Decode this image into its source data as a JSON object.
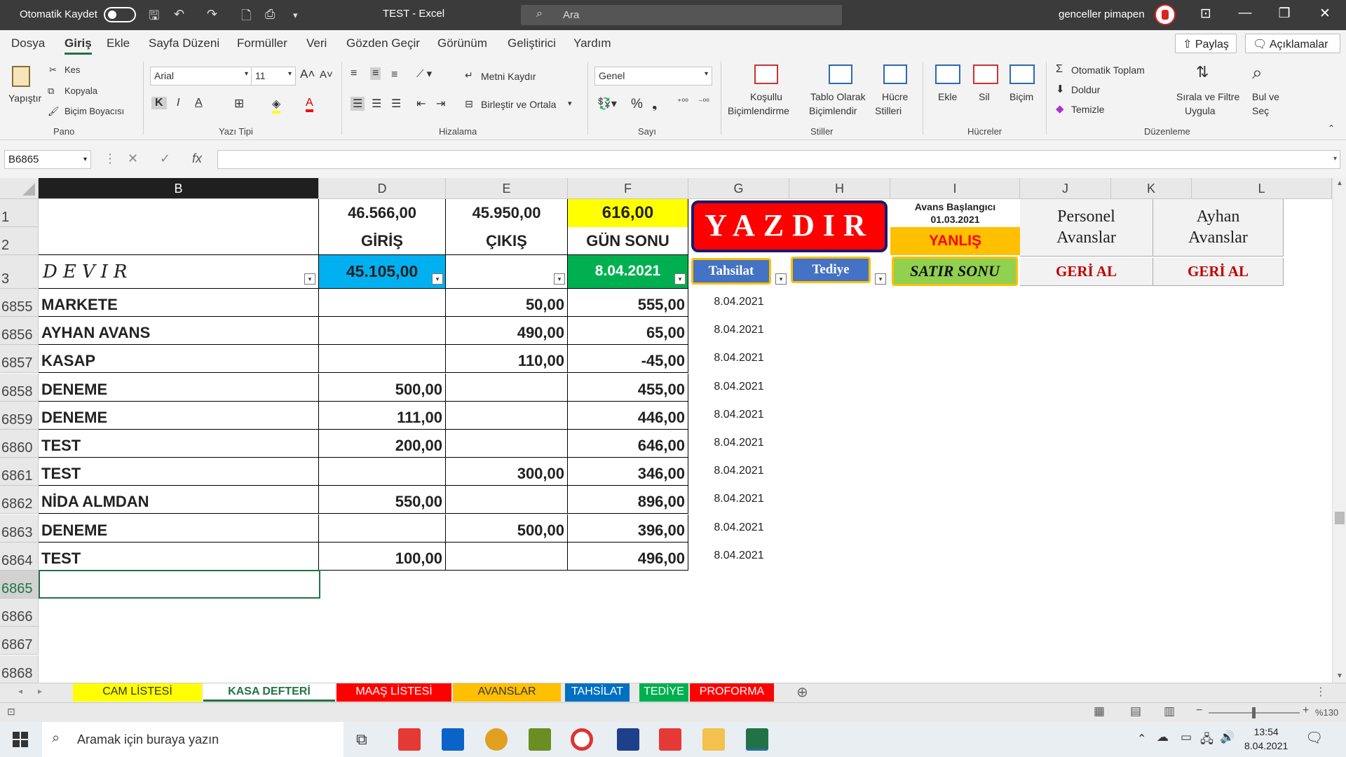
{
  "titlebar": {
    "autosave_label": "Otomatik Kaydet",
    "doc_title": "TEST  -  Excel",
    "search_placeholder": "Ara",
    "user_name": "genceller pimapen",
    "minimize": "—",
    "restore": "❐",
    "close": "✕",
    "display_icon": "⊡"
  },
  "menu": {
    "tabs": [
      "Dosya",
      "Giriş",
      "Ekle",
      "Sayfa Düzeni",
      "Formüller",
      "Veri",
      "Gözden Geçir",
      "Görünüm",
      "Geliştirici",
      "Yardım"
    ],
    "active_tab": "Giriş",
    "share_label": "Paylaş",
    "comments_label": "Açıklamalar"
  },
  "ribbon": {
    "clipboard": {
      "paste": "Yapıştır",
      "cut": "Kes",
      "copy": "Kopyala",
      "format_painter": "Biçim Boyacısı",
      "group": "Pano"
    },
    "font": {
      "name": "Arial",
      "size": "11",
      "bold": "K",
      "italic": "I",
      "underline": "A",
      "group": "Yazı Tipi"
    },
    "alignment": {
      "wrap": "Metni Kaydır",
      "merge": "Birleştir ve Ortala",
      "group": "Hizalama"
    },
    "number": {
      "format": "Genel",
      "group": "Sayı"
    },
    "styles": {
      "conditional": [
        "Koşullu",
        "Biçimlendirme"
      ],
      "table": [
        "Tablo Olarak",
        "Biçimlendir"
      ],
      "cell_styles": [
        "Hücre",
        "Stilleri"
      ],
      "group": "Stiller"
    },
    "cells": {
      "insert": "Ekle",
      "delete": "Sil",
      "format": "Biçim",
      "group": "Hücreler"
    },
    "editing": {
      "autosum": "Otomatik Toplam",
      "fill": "Doldur",
      "clear": "Temizle",
      "sort": [
        "Sırala ve Filtre",
        "Uygula"
      ],
      "find": [
        "Bul ve",
        "Seç"
      ],
      "group": "Düzenleme"
    }
  },
  "formula_bar": {
    "name_box": "B6865",
    "formula": ""
  },
  "columns": [
    "B",
    "D",
    "E",
    "F",
    "G",
    "H",
    "I",
    "J",
    "K",
    "L"
  ],
  "header_block": {
    "d1": "46.566,00",
    "d2": "GİRİŞ",
    "e1": "45.950,00",
    "e2": "ÇIKIŞ",
    "f1": "616,00",
    "f2": "GÜN SONU",
    "b3": "DEVIR",
    "d3": "45.105,00",
    "f3": "8.04.2021",
    "yazdir": "YAZDIR",
    "avans_label": "Avans Başlangıcı",
    "avans_date": "01.03.2021",
    "yanlis": "YANLIŞ",
    "tahsilat_btn": "Tahsilat",
    "tediye_btn": "Tediye",
    "satir_sonu_btn": "SATIR SONU",
    "personel": [
      "Personel",
      "Avanslar"
    ],
    "ayhan": [
      "Ayhan",
      "Avanslar"
    ],
    "geri_al_1": "GERİ AL",
    "geri_al_2": "GERİ AL"
  },
  "rows": [
    {
      "num": "6855",
      "b": "MARKETE",
      "d": "",
      "e": "50,00",
      "f": "555,00",
      "g": "8.04.2021"
    },
    {
      "num": "6856",
      "b": "AYHAN AVANS",
      "d": "",
      "e": "490,00",
      "f": "65,00",
      "g": "8.04.2021"
    },
    {
      "num": "6857",
      "b": "KASAP",
      "d": "",
      "e": "110,00",
      "f": "-45,00",
      "g": "8.04.2021"
    },
    {
      "num": "6858",
      "b": "DENEME",
      "d": "500,00",
      "e": "",
      "f": "455,00",
      "g": "8.04.2021"
    },
    {
      "num": "6859",
      "b": "DENEME",
      "d": "111,00",
      "e": "",
      "f": "446,00",
      "g": "8.04.2021"
    },
    {
      "num": "6860",
      "b": "TEST",
      "d": "200,00",
      "e": "",
      "f": "646,00",
      "g": "8.04.2021"
    },
    {
      "num": "6861",
      "b": "TEST",
      "d": "",
      "e": "300,00",
      "f": "346,00",
      "g": "8.04.2021"
    },
    {
      "num": "6862",
      "b": "NİDA ALMDAN",
      "d": "550,00",
      "e": "",
      "f": "896,00",
      "g": "8.04.2021"
    },
    {
      "num": "6863",
      "b": "DENEME",
      "d": "",
      "e": "500,00",
      "f": "396,00",
      "g": "8.04.2021"
    },
    {
      "num": "6864",
      "b": "TEST",
      "d": "100,00",
      "e": "",
      "f": "496,00",
      "g": "8.04.2021"
    }
  ],
  "empty_rows": [
    "6865",
    "6866",
    "6867",
    "6868"
  ],
  "top_rows": [
    "1",
    "2",
    "3"
  ],
  "sheet_tabs": [
    {
      "label": "CAM LİSTESİ",
      "bg": "#ffff00",
      "fg": "#333333"
    },
    {
      "label": "KASA DEFTERİ",
      "bg": "#ffffff",
      "fg": "#217346"
    },
    {
      "label": "MAAŞ LİSTESİ",
      "bg": "#ff0000",
      "fg": "#ffffff"
    },
    {
      "label": "AVANSLAR",
      "bg": "#ffc000",
      "fg": "#333333"
    },
    {
      "label": "TAHSİLAT",
      "bg": "#0070c0",
      "fg": "#ffffff"
    },
    {
      "label": "TEDİYE",
      "bg": "#00b050",
      "fg": "#ffffff"
    },
    {
      "label": "PROFORMA",
      "bg": "#ff0000",
      "fg": "#ffffff"
    }
  ],
  "status": {
    "zoom": "%130"
  },
  "taskbar": {
    "search_placeholder": "Aramak için buraya yazın",
    "time": "13:54",
    "date": "8.04.2021"
  }
}
